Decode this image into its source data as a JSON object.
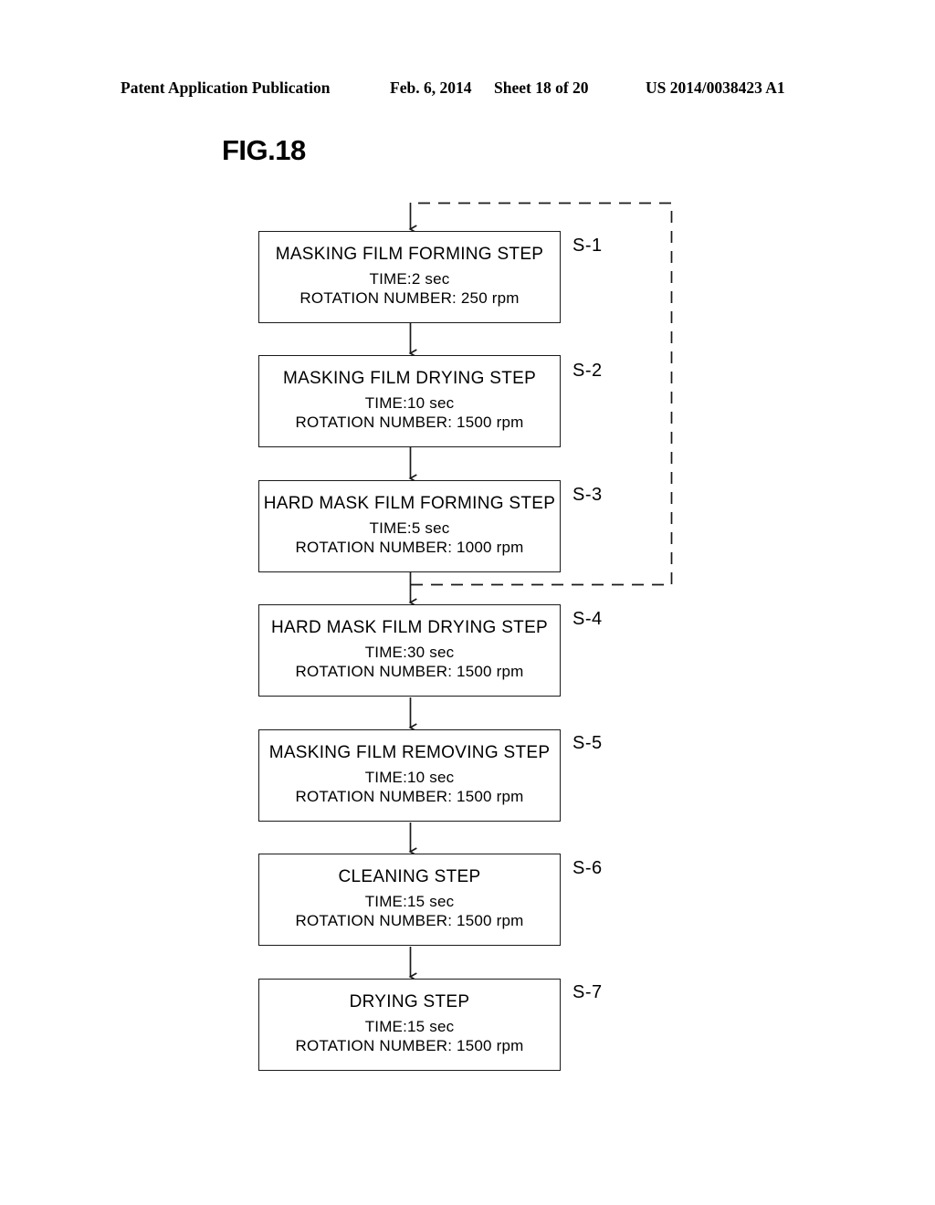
{
  "header": {
    "publication": "Patent Application Publication",
    "date": "Feb. 6, 2014",
    "sheet": "Sheet 18 of 20",
    "patent_number": "US 2014/0038423 A1"
  },
  "figure": {
    "title": "FIG.18",
    "type": "flowchart",
    "line_color": "#1a1a1a",
    "background": "#ffffff",
    "feedback_loop": {
      "style": "dashed",
      "from_step": "S-3",
      "to_step": "S-1",
      "description": "dashed return path from below HARD MASK FILM FORMING STEP back to above MASKING FILM FORMING STEP"
    },
    "steps": [
      {
        "ref": "S-1",
        "title": "MASKING FILM FORMING STEP",
        "time": "TIME:2 sec",
        "rotation": "ROTATION NUMBER: 250 rpm"
      },
      {
        "ref": "S-2",
        "title": "MASKING FILM DRYING STEP",
        "time": "TIME:10 sec",
        "rotation": "ROTATION NUMBER: 1500 rpm"
      },
      {
        "ref": "S-3",
        "title": "HARD MASK FILM FORMING STEP",
        "time": "TIME:5 sec",
        "rotation": "ROTATION NUMBER: 1000 rpm"
      },
      {
        "ref": "S-4",
        "title": "HARD MASK FILM DRYING STEP",
        "time": "TIME:30 sec",
        "rotation": "ROTATION NUMBER: 1500 rpm"
      },
      {
        "ref": "S-5",
        "title": "MASKING FILM REMOVING STEP",
        "time": "TIME:10 sec",
        "rotation": "ROTATION NUMBER: 1500 rpm"
      },
      {
        "ref": "S-6",
        "title": "CLEANING STEP",
        "time": "TIME:15 sec",
        "rotation": "ROTATION NUMBER: 1500 rpm"
      },
      {
        "ref": "S-7",
        "title": "DRYING STEP",
        "time": "TIME:15 sec",
        "rotation": "ROTATION NUMBER: 1500 rpm"
      }
    ]
  }
}
